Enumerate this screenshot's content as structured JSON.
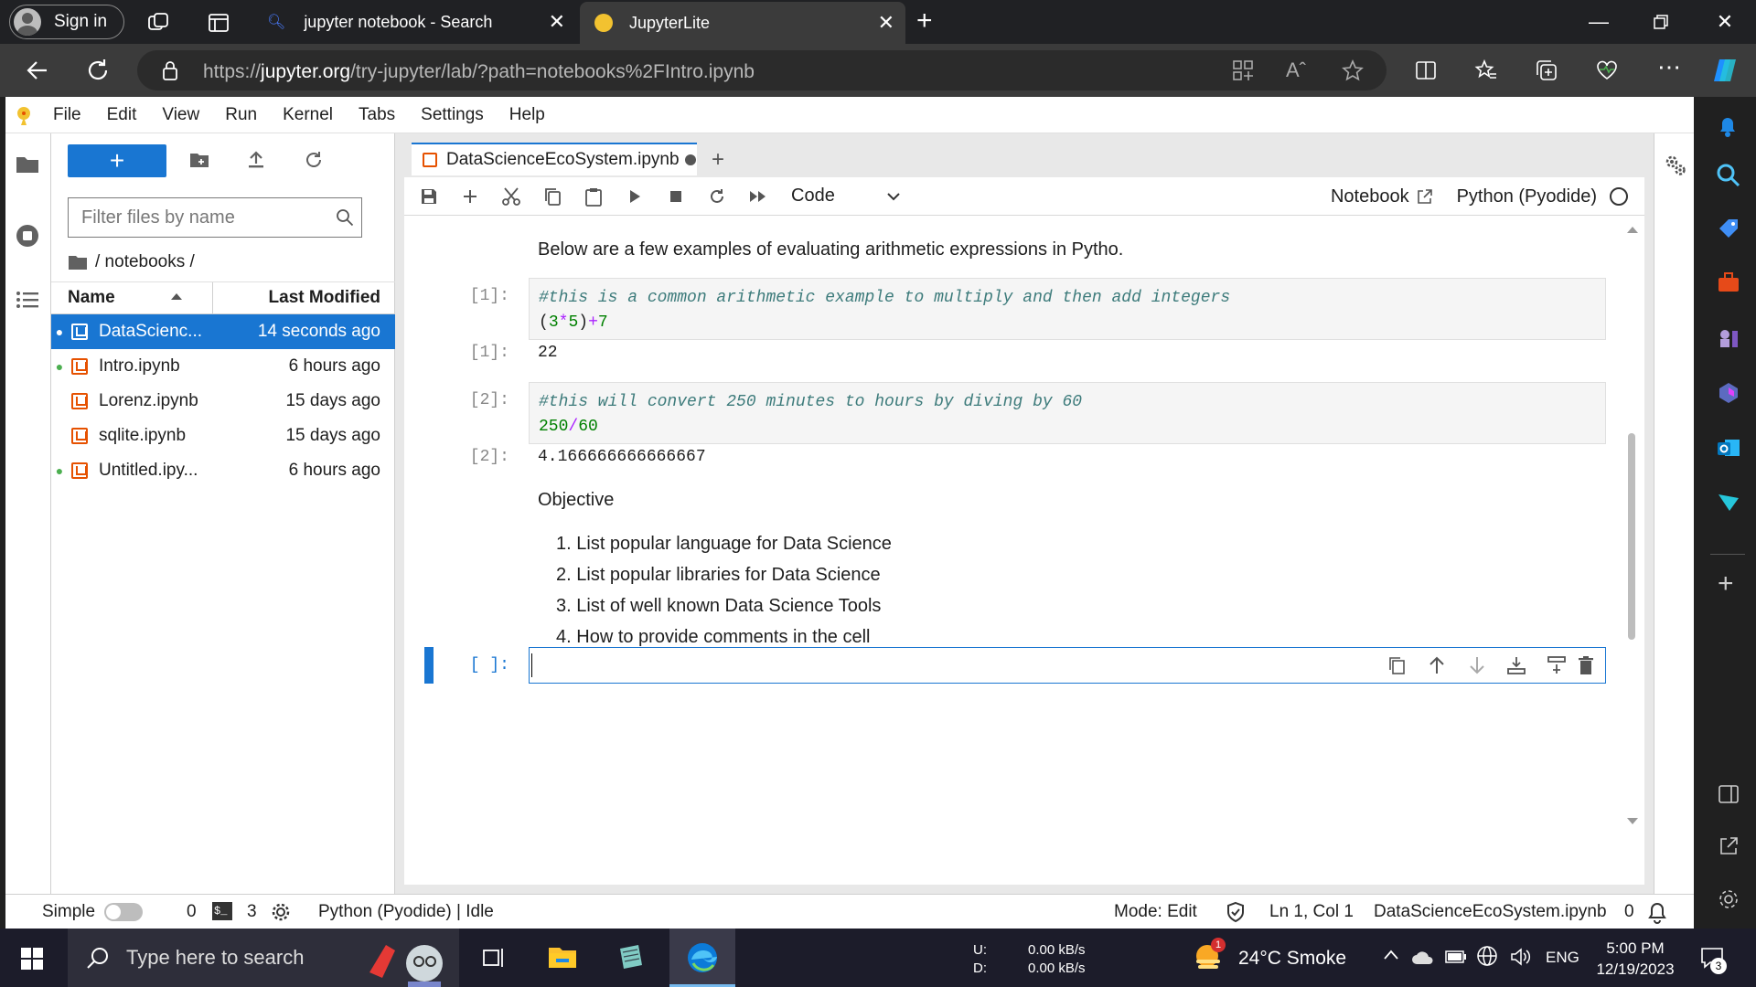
{
  "browser": {
    "signin_label": "Sign in",
    "tabs": [
      {
        "title": "jupyter notebook - Search"
      },
      {
        "title": "JupyterLite"
      }
    ],
    "url_prefix": "https://",
    "url_host": "jupyter.org",
    "url_path": "/try-jupyter/lab/?path=notebooks%2FIntro.ipynb"
  },
  "menubar": {
    "items": [
      "File",
      "Edit",
      "View",
      "Run",
      "Kernel",
      "Tabs",
      "Settings",
      "Help"
    ]
  },
  "filebrowser": {
    "new_button_label": "+",
    "filter_placeholder": "Filter files by name",
    "breadcrumb": "/ notebooks /",
    "columns": {
      "name": "Name",
      "modified": "Last Modified"
    },
    "files": [
      {
        "name": "DataScienc...",
        "modified": "14 seconds ago",
        "selected": true,
        "running": true
      },
      {
        "name": "Intro.ipynb",
        "modified": "6 hours ago",
        "selected": false,
        "running": true
      },
      {
        "name": "Lorenz.ipynb",
        "modified": "15 days ago",
        "selected": false,
        "running": false
      },
      {
        "name": "sqlite.ipynb",
        "modified": "15 days ago",
        "selected": false,
        "running": false
      },
      {
        "name": "Untitled.ipy...",
        "modified": "6 hours ago",
        "selected": false,
        "running": true
      }
    ]
  },
  "notebook": {
    "tab_title": "DataScienceEcoSystem.ipynb",
    "cell_type": "Code",
    "notebook_link": "Notebook",
    "kernel": "Python (Pyodide)",
    "intro_markdown": "Below are a few examples of evaluating arithmetic expressions in Pytho.",
    "cells": [
      {
        "prompt": "[1]:",
        "comment": "#this is a common arithmetic example to multiply and then add integers",
        "code_parts": [
          "(",
          "3",
          "*",
          "5",
          ")",
          "+",
          "7"
        ],
        "output_prompt": "[1]:",
        "output": "22"
      },
      {
        "prompt": "[2]:",
        "comment": "#this will convert 250 minutes to hours by diving by 60",
        "code_parts": [
          "250",
          "/",
          "60"
        ],
        "output_prompt": "[2]:",
        "output": "4.166666666666667"
      }
    ],
    "objective_heading": "Objective",
    "objectives": [
      "List popular language for Data Science",
      "List popular libraries for Data Science",
      "List of well known Data Science Tools",
      "How to provide comments in the cell"
    ],
    "empty_prompt": "[ ]:"
  },
  "statusbar": {
    "simple_label": "Simple",
    "terminals": "0",
    "kernels": "3",
    "kernel_status": "Python (Pyodide) | Idle",
    "mode": "Mode: Edit",
    "cursor": "Ln 1, Col 1",
    "filename": "DataScienceEcoSystem.ipynb",
    "notifications": "0"
  },
  "taskbar": {
    "search_placeholder": "Type here to search",
    "net_up_label": "U:",
    "net_up": "0.00 kB/s",
    "net_down_label": "D:",
    "net_down": "0.00 kB/s",
    "weather": "24°C  Smoke",
    "weather_badge": "1",
    "language": "ENG",
    "time": "5:00 PM",
    "date": "12/19/2023",
    "notification_count": "3"
  },
  "colors": {
    "accent": "#1976d2",
    "notebook_orange": "#e65100",
    "running_green": "#4caf50"
  }
}
